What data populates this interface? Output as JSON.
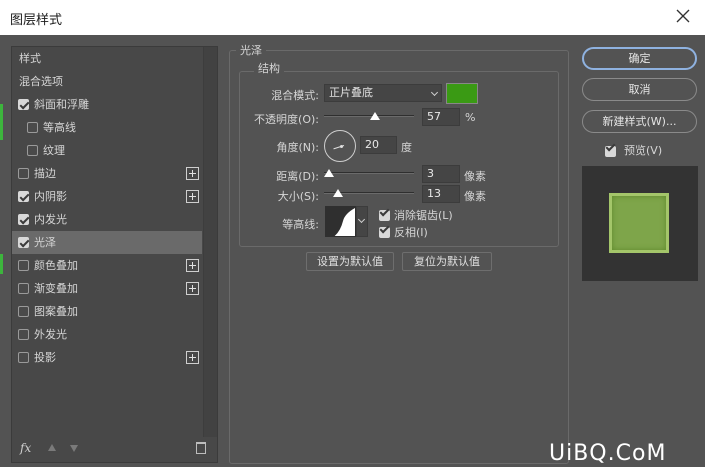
{
  "window": {
    "title": "图层样式"
  },
  "left_panel": {
    "items": [
      {
        "label": "样式",
        "type": "plain",
        "checked": null,
        "plus": false,
        "selected": false
      },
      {
        "label": "混合选项",
        "type": "plain",
        "checked": null,
        "plus": false,
        "selected": false
      },
      {
        "label": "斜面和浮雕",
        "type": "lvl1",
        "checked": true,
        "plus": false,
        "selected": false
      },
      {
        "label": "等高线",
        "type": "lvl2",
        "checked": false,
        "plus": false,
        "selected": false
      },
      {
        "label": "纹理",
        "type": "lvl2",
        "checked": false,
        "plus": false,
        "selected": false
      },
      {
        "label": "描边",
        "type": "lvl1",
        "checked": false,
        "plus": true,
        "selected": false
      },
      {
        "label": "内阴影",
        "type": "lvl1",
        "checked": true,
        "plus": true,
        "selected": false
      },
      {
        "label": "内发光",
        "type": "lvl1",
        "checked": true,
        "plus": false,
        "selected": false
      },
      {
        "label": "光泽",
        "type": "lvl1",
        "checked": true,
        "plus": false,
        "selected": true
      },
      {
        "label": "颜色叠加",
        "type": "lvl1",
        "checked": false,
        "plus": true,
        "selected": false
      },
      {
        "label": "渐变叠加",
        "type": "lvl1",
        "checked": false,
        "plus": true,
        "selected": false
      },
      {
        "label": "图案叠加",
        "type": "lvl1",
        "checked": false,
        "plus": false,
        "selected": false
      },
      {
        "label": "外发光",
        "type": "lvl1",
        "checked": false,
        "plus": false,
        "selected": false
      },
      {
        "label": "投影",
        "type": "lvl1",
        "checked": false,
        "plus": true,
        "selected": false
      }
    ],
    "fx_label": "fx"
  },
  "satin": {
    "group_title": "光泽",
    "structure_title": "结构",
    "blend_mode_label": "混合模式:",
    "blend_mode_value": "正片叠底",
    "color": "#3a9a14",
    "opacity_label": "不透明度(O):",
    "opacity_value": "57",
    "opacity_unit": "%",
    "opacity_fraction": 0.57,
    "angle_label": "角度(N):",
    "angle_value": "20",
    "angle_unit": "度",
    "distance_label": "距离(D):",
    "distance_value": "3",
    "distance_unit": "像素",
    "size_label": "大小(S):",
    "size_value": "13",
    "size_unit": "像素",
    "contour_label": "等高线:",
    "anti_alias_label": "消除锯齿(L)",
    "anti_alias_checked": true,
    "invert_label": "反相(I)",
    "invert_checked": true,
    "set_default_label": "设置为默认值",
    "reset_default_label": "复位为默认值"
  },
  "right_panel": {
    "ok_label": "确定",
    "cancel_label": "取消",
    "new_style_label": "新建样式(W)...",
    "preview_label": "预览(V)",
    "preview_checked": true,
    "accent": "#8fb2e0"
  },
  "watermark": "UiBQ.CoM"
}
